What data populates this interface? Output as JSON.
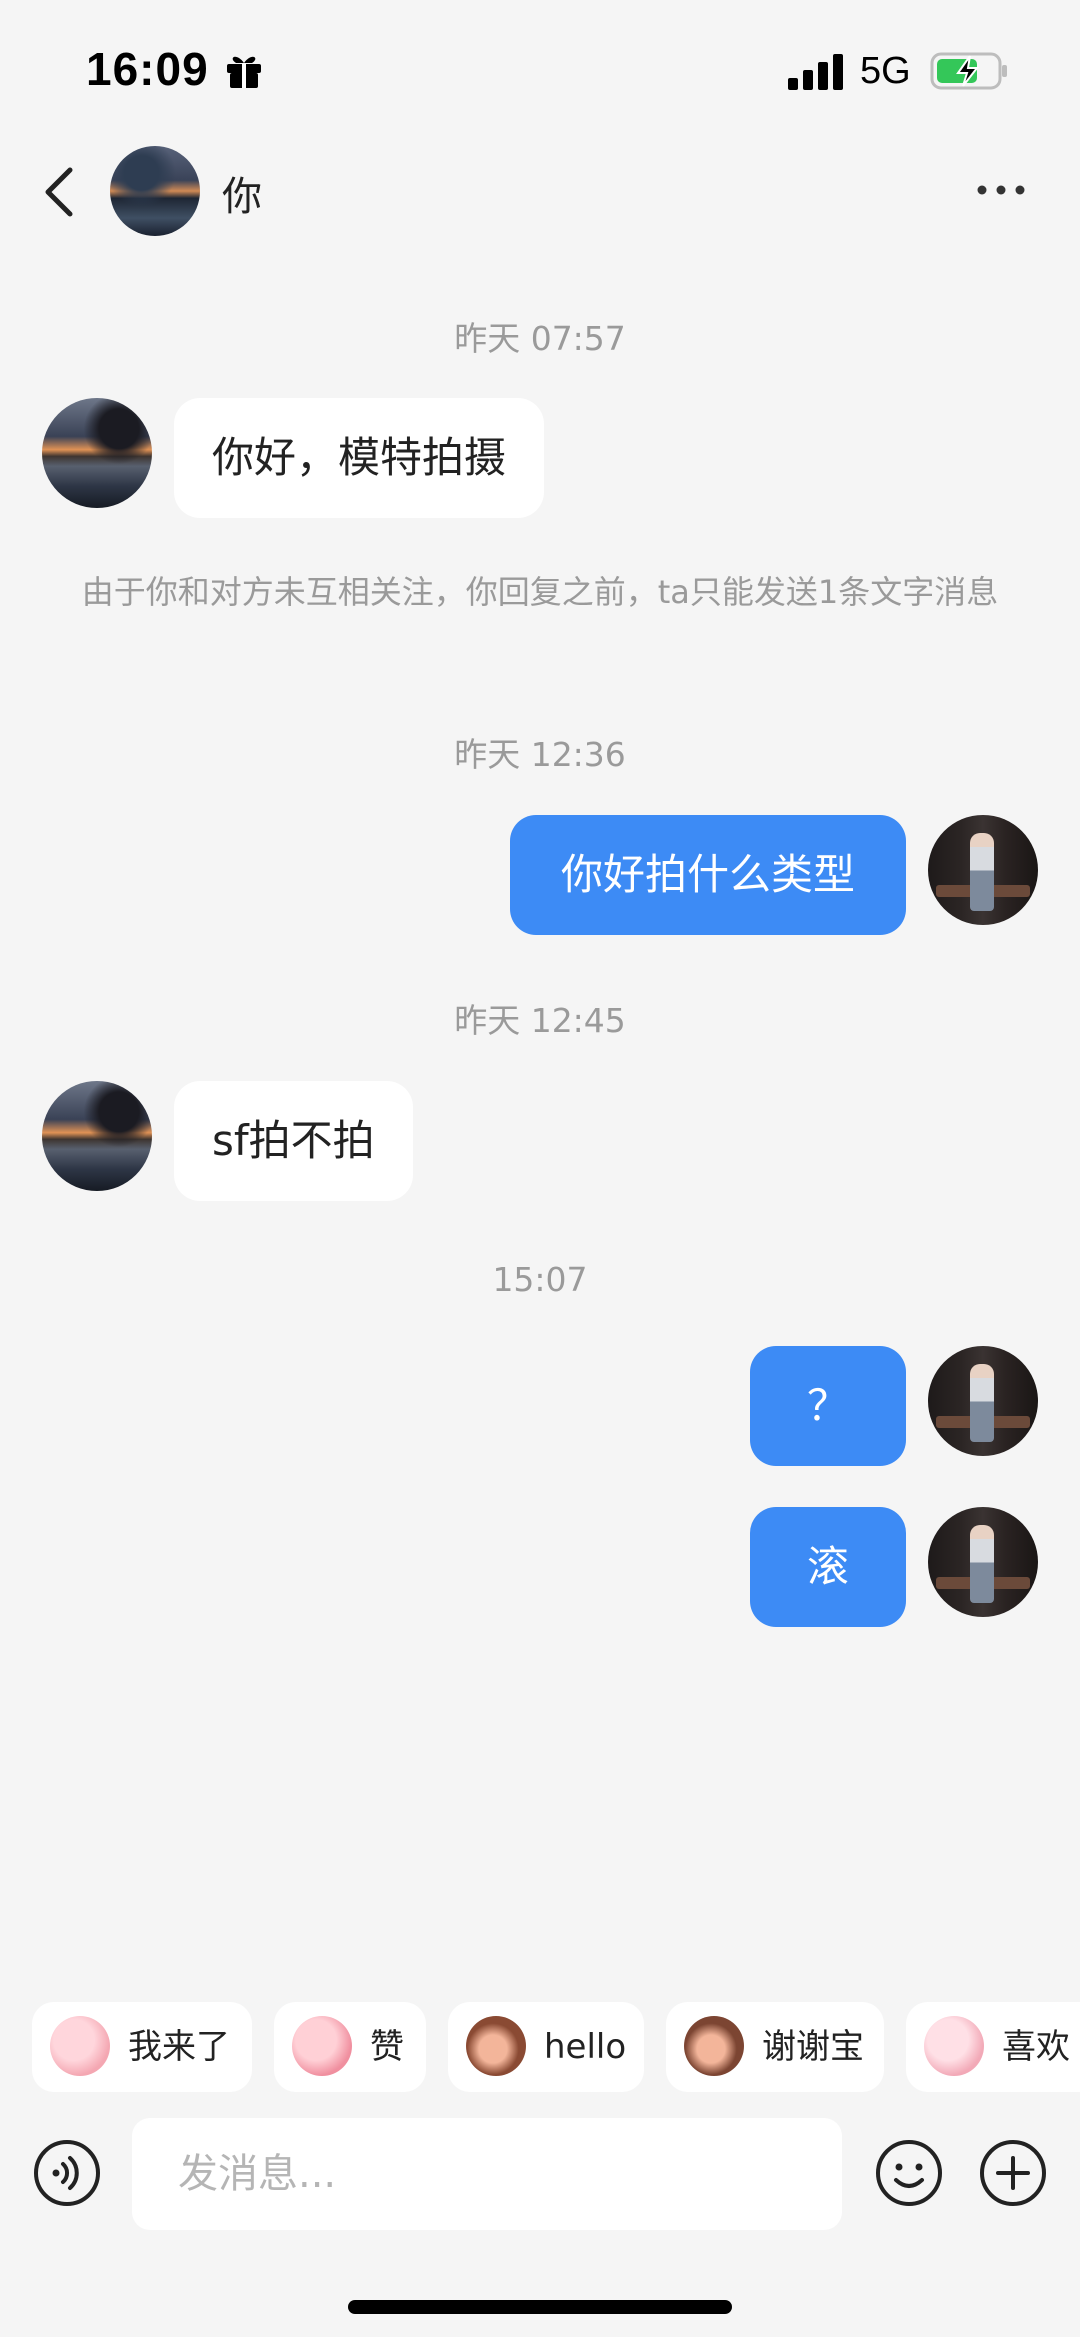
{
  "status_bar": {
    "time": "16:09",
    "network": "5G",
    "icons": [
      "gift-icon",
      "signal-icon",
      "battery-charging-icon"
    ]
  },
  "header": {
    "name": "你",
    "icons": [
      "chevron-left-icon",
      "more-horizontal-icon"
    ]
  },
  "messages": {
    "ts1": "昨天 07:57",
    "m1": "你好，模特拍摄",
    "notice": "由于你和对方未互相关注，你回复之前，ta只能发送1条文字消息",
    "ts2": "昨天 12:36",
    "m2": "你好拍什么类型",
    "ts3": "昨天 12:45",
    "m3": "sf拍不拍",
    "ts4": "15:07",
    "m4": "？",
    "m5": "滚"
  },
  "stickers": [
    {
      "label": "我来了",
      "icon": "pig-sticker-icon"
    },
    {
      "label": "赞",
      "icon": "pig-sticker-icon"
    },
    {
      "label": "hello",
      "icon": "monkey-sticker-icon"
    },
    {
      "label": "谢谢宝",
      "icon": "monkey-sticker-icon"
    },
    {
      "label": "喜欢",
      "icon": "pig-sticker-icon"
    }
  ],
  "composer": {
    "placeholder": "发消息...",
    "icons": [
      "voice-icon",
      "emoji-icon",
      "plus-icon"
    ]
  },
  "colors": {
    "background": "#f5f5f5",
    "self_bubble": "#3d8bf5",
    "peer_bubble": "#ffffff",
    "timestamp": "#9a9a9a"
  }
}
